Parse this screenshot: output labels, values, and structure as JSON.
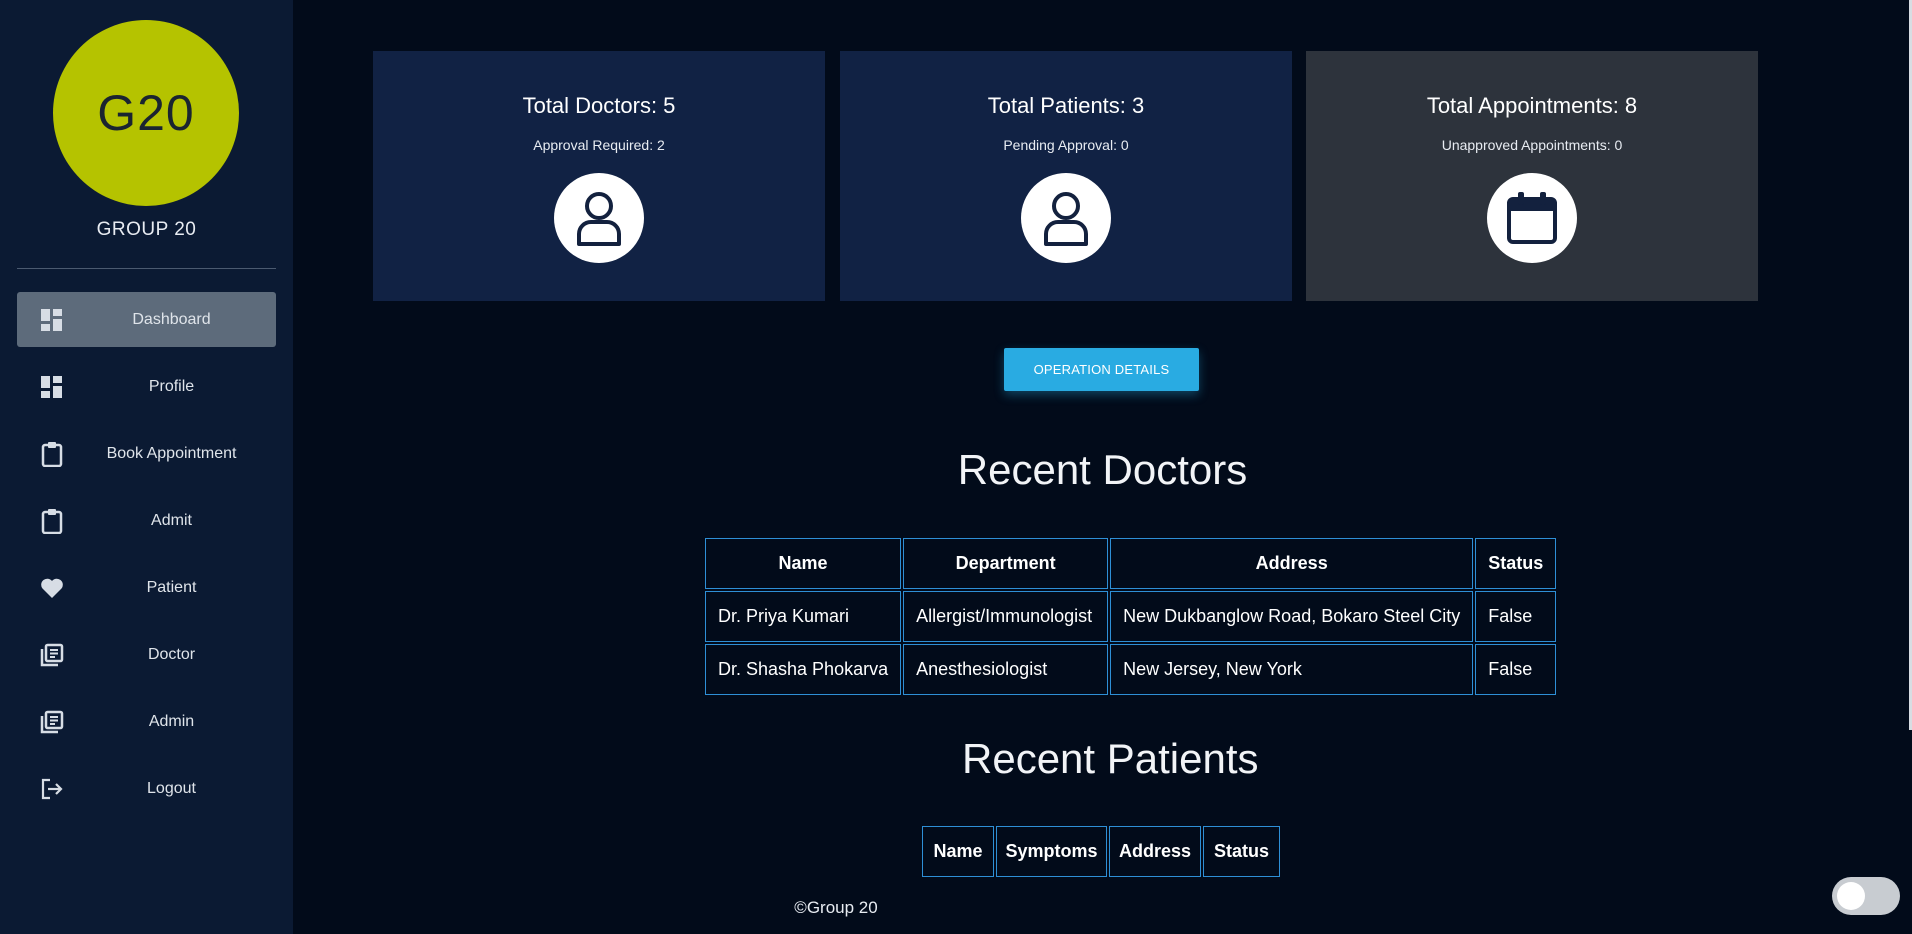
{
  "sidebar": {
    "avatar_text": "G20",
    "group_name": "GROUP 20",
    "items": [
      {
        "label": "Dashboard",
        "icon": "dashboard-icon"
      },
      {
        "label": "Profile",
        "icon": "dashboard-icon"
      },
      {
        "label": "Book Appointment",
        "icon": "clipboard-icon"
      },
      {
        "label": "Admit",
        "icon": "clipboard-icon"
      },
      {
        "label": "Patient",
        "icon": "heart-icon"
      },
      {
        "label": "Doctor",
        "icon": "library-books-icon"
      },
      {
        "label": "Admin",
        "icon": "library-books-icon"
      },
      {
        "label": "Logout",
        "icon": "logout-icon"
      }
    ],
    "active_item": "Dashboard"
  },
  "cards": [
    {
      "title": "Total Doctors: 5",
      "subtitle": "Approval Required: 2",
      "icon": "user-icon"
    },
    {
      "title": "Total Patients: 3",
      "subtitle": "Pending Approval: 0",
      "icon": "user-icon"
    },
    {
      "title": "Total Appointments: 8",
      "subtitle": "Unapproved Appointments: 0",
      "icon": "calendar-icon"
    }
  ],
  "operation_button": "OPERATION DETAILS",
  "recent_doctors": {
    "heading": "Recent Doctors",
    "columns": [
      "Name",
      "Department",
      "Address",
      "Status"
    ],
    "rows": [
      [
        "Dr. Priya Kumari",
        "Allergist/Immunologist",
        "New Dukbanglow Road, Bokaro Steel City",
        "False"
      ],
      [
        "Dr. Shasha Phokarva",
        "Anesthesiologist",
        "New Jersey, New York",
        "False"
      ]
    ]
  },
  "recent_patients": {
    "heading": "Recent Patients",
    "columns": [
      "Name",
      "Symptoms",
      "Address",
      "Status"
    ],
    "rows": []
  },
  "footer": "©Group 20",
  "theme_toggle": {
    "state": "off"
  },
  "colors": {
    "page_bg": "#020b1a",
    "sidebar_bg": "#0b1a33",
    "avatar": "#b5c300",
    "card_bg": "#112244",
    "card_grey": "#2d333c",
    "button": "#29abe2",
    "table_border": "#2e8fd6"
  }
}
